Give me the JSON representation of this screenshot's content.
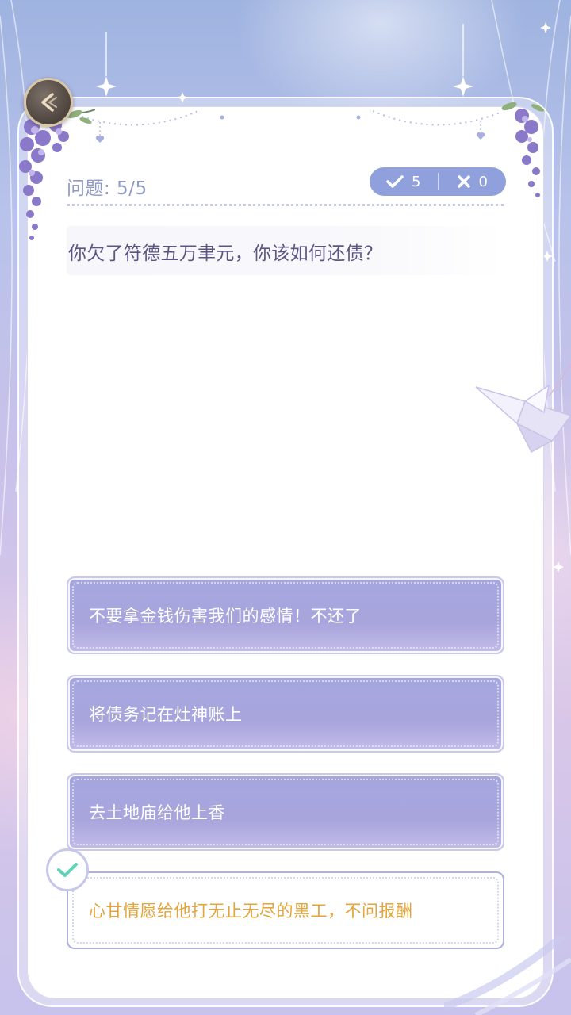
{
  "quiz": {
    "progress_label": "问题: 5/5",
    "score": {
      "correct_count": "5",
      "wrong_count": "0"
    },
    "question": "你欠了符德五万聿元，你该如何还债？",
    "options": [
      {
        "label": "不要拿金钱伤害我们的感情！不还了",
        "selected": false
      },
      {
        "label": "将债务记在灶神账上",
        "selected": false
      },
      {
        "label": "去土地庙给他上香",
        "selected": false
      },
      {
        "label": "心甘情愿给他打无止无尽的黑工，不问报酬",
        "selected": true
      }
    ]
  },
  "icons": {
    "back": "back-arrow-icon",
    "correct": "check-icon",
    "wrong": "cross-icon",
    "selected": "check-icon"
  },
  "colors": {
    "option_fill": "#a6a6de",
    "selected_text": "#e3a43b",
    "score_pill": "#8fa0dc",
    "question_text": "#5c5584",
    "progress_text": "#8f99c6",
    "check_mark": "#5ed3b8"
  }
}
